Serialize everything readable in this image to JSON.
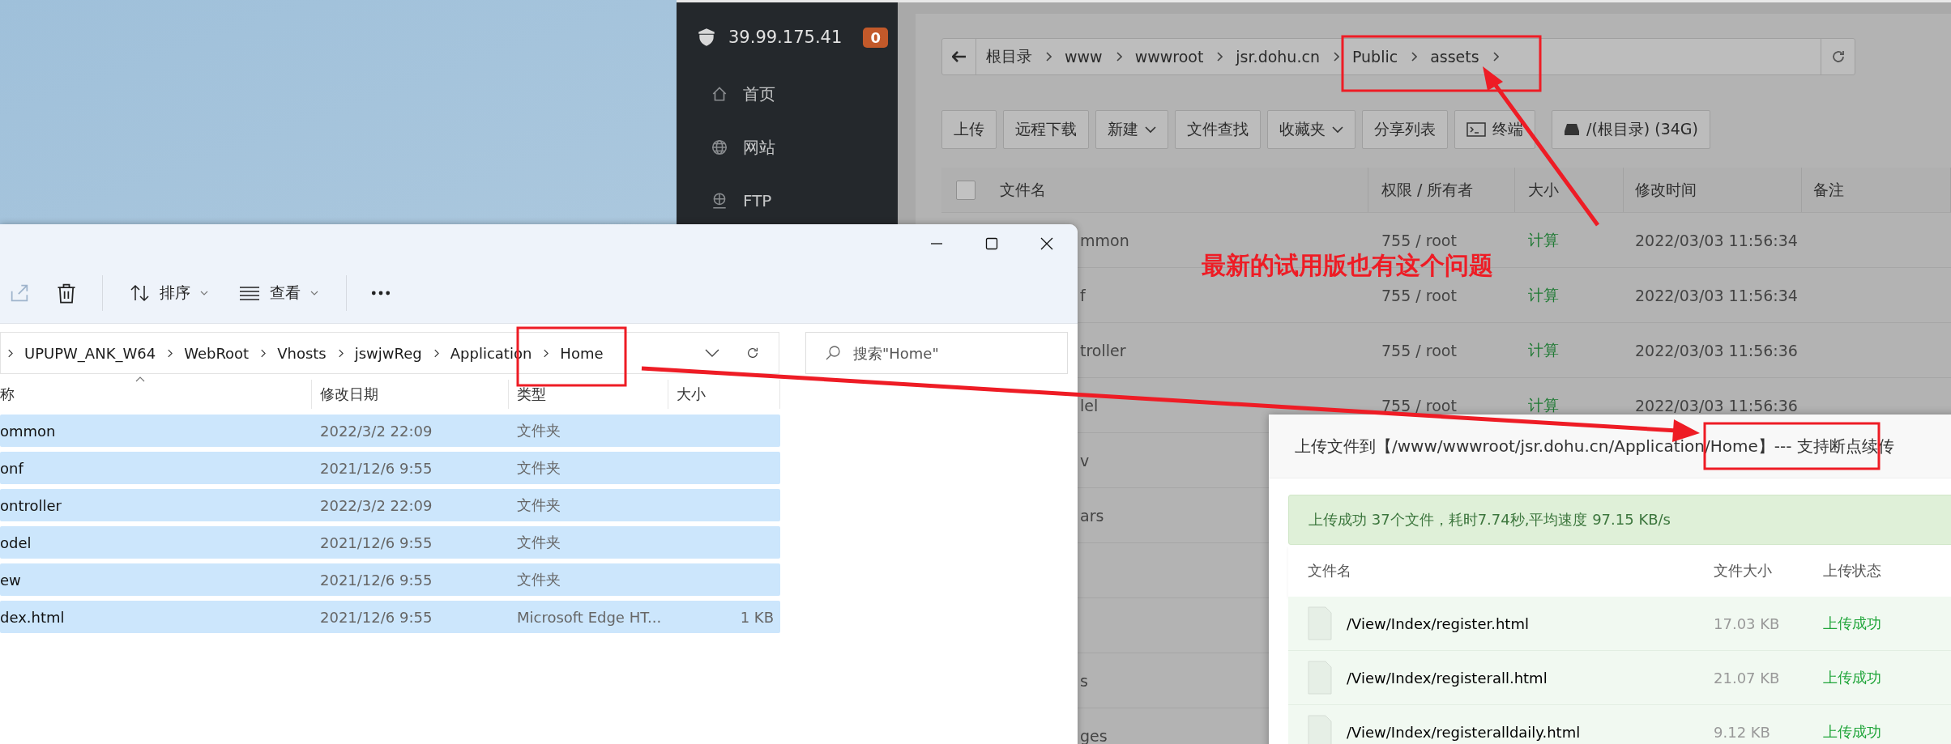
{
  "panel": {
    "server_ip": "39.99.175.41",
    "badge": "0",
    "nav": [
      {
        "kind": "home",
        "label": "首页"
      },
      {
        "kind": "site",
        "label": "网站"
      },
      {
        "kind": "ftp",
        "label": "FTP"
      }
    ],
    "breadcrumb": [
      "根目录",
      "www",
      "wwwroot",
      "jsr.dohu.cn",
      "Public",
      "assets"
    ],
    "toolbar": [
      {
        "kind": "button",
        "label": "上传"
      },
      {
        "kind": "button",
        "label": "远程下载"
      },
      {
        "kind": "dropdown",
        "label": "新建"
      },
      {
        "kind": "button",
        "label": "文件查找"
      },
      {
        "kind": "dropdown",
        "label": "收藏夹"
      },
      {
        "kind": "button",
        "label": "分享列表"
      },
      {
        "kind": "terminal",
        "label": "终端"
      },
      {
        "kind": "disk",
        "label": "/(根目录) (34G)"
      }
    ],
    "table": {
      "select_all_checked": false,
      "columns": [
        "文件名",
        "权限 / 所有者",
        "大小",
        "修改时间",
        "备注"
      ],
      "rows": [
        {
          "name": "mmon",
          "permissions": "755 / root",
          "size": "计算",
          "modified": "2022/03/03 11:56:34"
        },
        {
          "name": "f",
          "permissions": "755 / root",
          "size": "计算",
          "modified": "2022/03/03 11:56:34"
        },
        {
          "name": "troller",
          "permissions": "755 / root",
          "size": "计算",
          "modified": "2022/03/03 11:56:36"
        },
        {
          "name": "lel",
          "permissions": "755 / root",
          "size": "计算",
          "modified": "2022/03/03 11:56:36"
        },
        {
          "name": "v"
        },
        {
          "name": "ars"
        },
        {
          "name": ""
        },
        {
          "name": ""
        },
        {
          "name": "s"
        },
        {
          "name": "ges"
        }
      ]
    }
  },
  "explorer": {
    "toolbar": [
      {
        "kind": "share",
        "disabled": true
      },
      {
        "kind": "delete",
        "disabled": false
      },
      {
        "kind": "sort",
        "label": "排序",
        "disabled": false
      },
      {
        "kind": "view",
        "label": "查看",
        "disabled": false
      },
      {
        "kind": "more",
        "disabled": false
      }
    ],
    "address": [
      "UPUPW_ANK_W64",
      "WebRoot",
      "Vhosts",
      "jswjwReg",
      "Application",
      "Home"
    ],
    "search": {
      "placeholder": "搜索\"Home\""
    },
    "columns": [
      "称",
      "修改日期",
      "类型",
      "大小"
    ],
    "rows": [
      {
        "name": "ommon",
        "date": "2022/3/2 22:09",
        "type": "文件夹",
        "selected": true
      },
      {
        "name": "onf",
        "date": "2021/12/6 9:55",
        "type": "文件夹",
        "selected": true
      },
      {
        "name": "ontroller",
        "date": "2022/3/2 22:09",
        "type": "文件夹",
        "selected": true
      },
      {
        "name": "odel",
        "date": "2021/12/6 9:55",
        "type": "文件夹",
        "selected": true
      },
      {
        "name": "ew",
        "date": "2021/12/6 9:55",
        "type": "文件夹",
        "selected": true
      },
      {
        "name": "dex.html",
        "date": "2021/12/6 9:55",
        "type": "Microsoft Edge HT...",
        "size": "1 KB",
        "selected": true
      }
    ]
  },
  "upload_dialog": {
    "title": "上传文件到【/www/wwwroot/jsr.dohu.cn/Application/Home】--- 支持断点续传",
    "message": "上传成功 37个文件，耗时7.74秒,平均速度 97.15 KB/s",
    "columns": [
      "文件名",
      "文件大小",
      "上传状态"
    ],
    "files": [
      {
        "name": "/View/Index/register.html",
        "size": "17.03 KB",
        "status": "上传成功"
      },
      {
        "name": "/View/Index/registerall.html",
        "size": "21.07 KB",
        "status": "上传成功"
      },
      {
        "name": "/View/Index/registeralldaily.html",
        "size": "9.12 KB",
        "status": "上传成功"
      }
    ]
  },
  "annotation": {
    "text": "最新的试用版也有这个问题"
  }
}
